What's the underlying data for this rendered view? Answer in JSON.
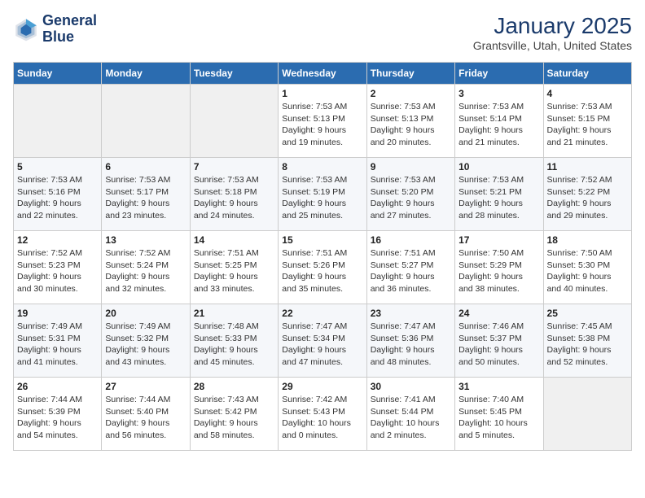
{
  "header": {
    "logo_line1": "General",
    "logo_line2": "Blue",
    "month": "January 2025",
    "location": "Grantsville, Utah, United States"
  },
  "weekdays": [
    "Sunday",
    "Monday",
    "Tuesday",
    "Wednesday",
    "Thursday",
    "Friday",
    "Saturday"
  ],
  "weeks": [
    [
      {
        "day": "",
        "info": ""
      },
      {
        "day": "",
        "info": ""
      },
      {
        "day": "",
        "info": ""
      },
      {
        "day": "1",
        "info": "Sunrise: 7:53 AM\nSunset: 5:13 PM\nDaylight: 9 hours\nand 19 minutes."
      },
      {
        "day": "2",
        "info": "Sunrise: 7:53 AM\nSunset: 5:13 PM\nDaylight: 9 hours\nand 20 minutes."
      },
      {
        "day": "3",
        "info": "Sunrise: 7:53 AM\nSunset: 5:14 PM\nDaylight: 9 hours\nand 21 minutes."
      },
      {
        "day": "4",
        "info": "Sunrise: 7:53 AM\nSunset: 5:15 PM\nDaylight: 9 hours\nand 21 minutes."
      }
    ],
    [
      {
        "day": "5",
        "info": "Sunrise: 7:53 AM\nSunset: 5:16 PM\nDaylight: 9 hours\nand 22 minutes."
      },
      {
        "day": "6",
        "info": "Sunrise: 7:53 AM\nSunset: 5:17 PM\nDaylight: 9 hours\nand 23 minutes."
      },
      {
        "day": "7",
        "info": "Sunrise: 7:53 AM\nSunset: 5:18 PM\nDaylight: 9 hours\nand 24 minutes."
      },
      {
        "day": "8",
        "info": "Sunrise: 7:53 AM\nSunset: 5:19 PM\nDaylight: 9 hours\nand 25 minutes."
      },
      {
        "day": "9",
        "info": "Sunrise: 7:53 AM\nSunset: 5:20 PM\nDaylight: 9 hours\nand 27 minutes."
      },
      {
        "day": "10",
        "info": "Sunrise: 7:53 AM\nSunset: 5:21 PM\nDaylight: 9 hours\nand 28 minutes."
      },
      {
        "day": "11",
        "info": "Sunrise: 7:52 AM\nSunset: 5:22 PM\nDaylight: 9 hours\nand 29 minutes."
      }
    ],
    [
      {
        "day": "12",
        "info": "Sunrise: 7:52 AM\nSunset: 5:23 PM\nDaylight: 9 hours\nand 30 minutes."
      },
      {
        "day": "13",
        "info": "Sunrise: 7:52 AM\nSunset: 5:24 PM\nDaylight: 9 hours\nand 32 minutes."
      },
      {
        "day": "14",
        "info": "Sunrise: 7:51 AM\nSunset: 5:25 PM\nDaylight: 9 hours\nand 33 minutes."
      },
      {
        "day": "15",
        "info": "Sunrise: 7:51 AM\nSunset: 5:26 PM\nDaylight: 9 hours\nand 35 minutes."
      },
      {
        "day": "16",
        "info": "Sunrise: 7:51 AM\nSunset: 5:27 PM\nDaylight: 9 hours\nand 36 minutes."
      },
      {
        "day": "17",
        "info": "Sunrise: 7:50 AM\nSunset: 5:29 PM\nDaylight: 9 hours\nand 38 minutes."
      },
      {
        "day": "18",
        "info": "Sunrise: 7:50 AM\nSunset: 5:30 PM\nDaylight: 9 hours\nand 40 minutes."
      }
    ],
    [
      {
        "day": "19",
        "info": "Sunrise: 7:49 AM\nSunset: 5:31 PM\nDaylight: 9 hours\nand 41 minutes."
      },
      {
        "day": "20",
        "info": "Sunrise: 7:49 AM\nSunset: 5:32 PM\nDaylight: 9 hours\nand 43 minutes."
      },
      {
        "day": "21",
        "info": "Sunrise: 7:48 AM\nSunset: 5:33 PM\nDaylight: 9 hours\nand 45 minutes."
      },
      {
        "day": "22",
        "info": "Sunrise: 7:47 AM\nSunset: 5:34 PM\nDaylight: 9 hours\nand 47 minutes."
      },
      {
        "day": "23",
        "info": "Sunrise: 7:47 AM\nSunset: 5:36 PM\nDaylight: 9 hours\nand 48 minutes."
      },
      {
        "day": "24",
        "info": "Sunrise: 7:46 AM\nSunset: 5:37 PM\nDaylight: 9 hours\nand 50 minutes."
      },
      {
        "day": "25",
        "info": "Sunrise: 7:45 AM\nSunset: 5:38 PM\nDaylight: 9 hours\nand 52 minutes."
      }
    ],
    [
      {
        "day": "26",
        "info": "Sunrise: 7:44 AM\nSunset: 5:39 PM\nDaylight: 9 hours\nand 54 minutes."
      },
      {
        "day": "27",
        "info": "Sunrise: 7:44 AM\nSunset: 5:40 PM\nDaylight: 9 hours\nand 56 minutes."
      },
      {
        "day": "28",
        "info": "Sunrise: 7:43 AM\nSunset: 5:42 PM\nDaylight: 9 hours\nand 58 minutes."
      },
      {
        "day": "29",
        "info": "Sunrise: 7:42 AM\nSunset: 5:43 PM\nDaylight: 10 hours\nand 0 minutes."
      },
      {
        "day": "30",
        "info": "Sunrise: 7:41 AM\nSunset: 5:44 PM\nDaylight: 10 hours\nand 2 minutes."
      },
      {
        "day": "31",
        "info": "Sunrise: 7:40 AM\nSunset: 5:45 PM\nDaylight: 10 hours\nand 5 minutes."
      },
      {
        "day": "",
        "info": ""
      }
    ]
  ]
}
